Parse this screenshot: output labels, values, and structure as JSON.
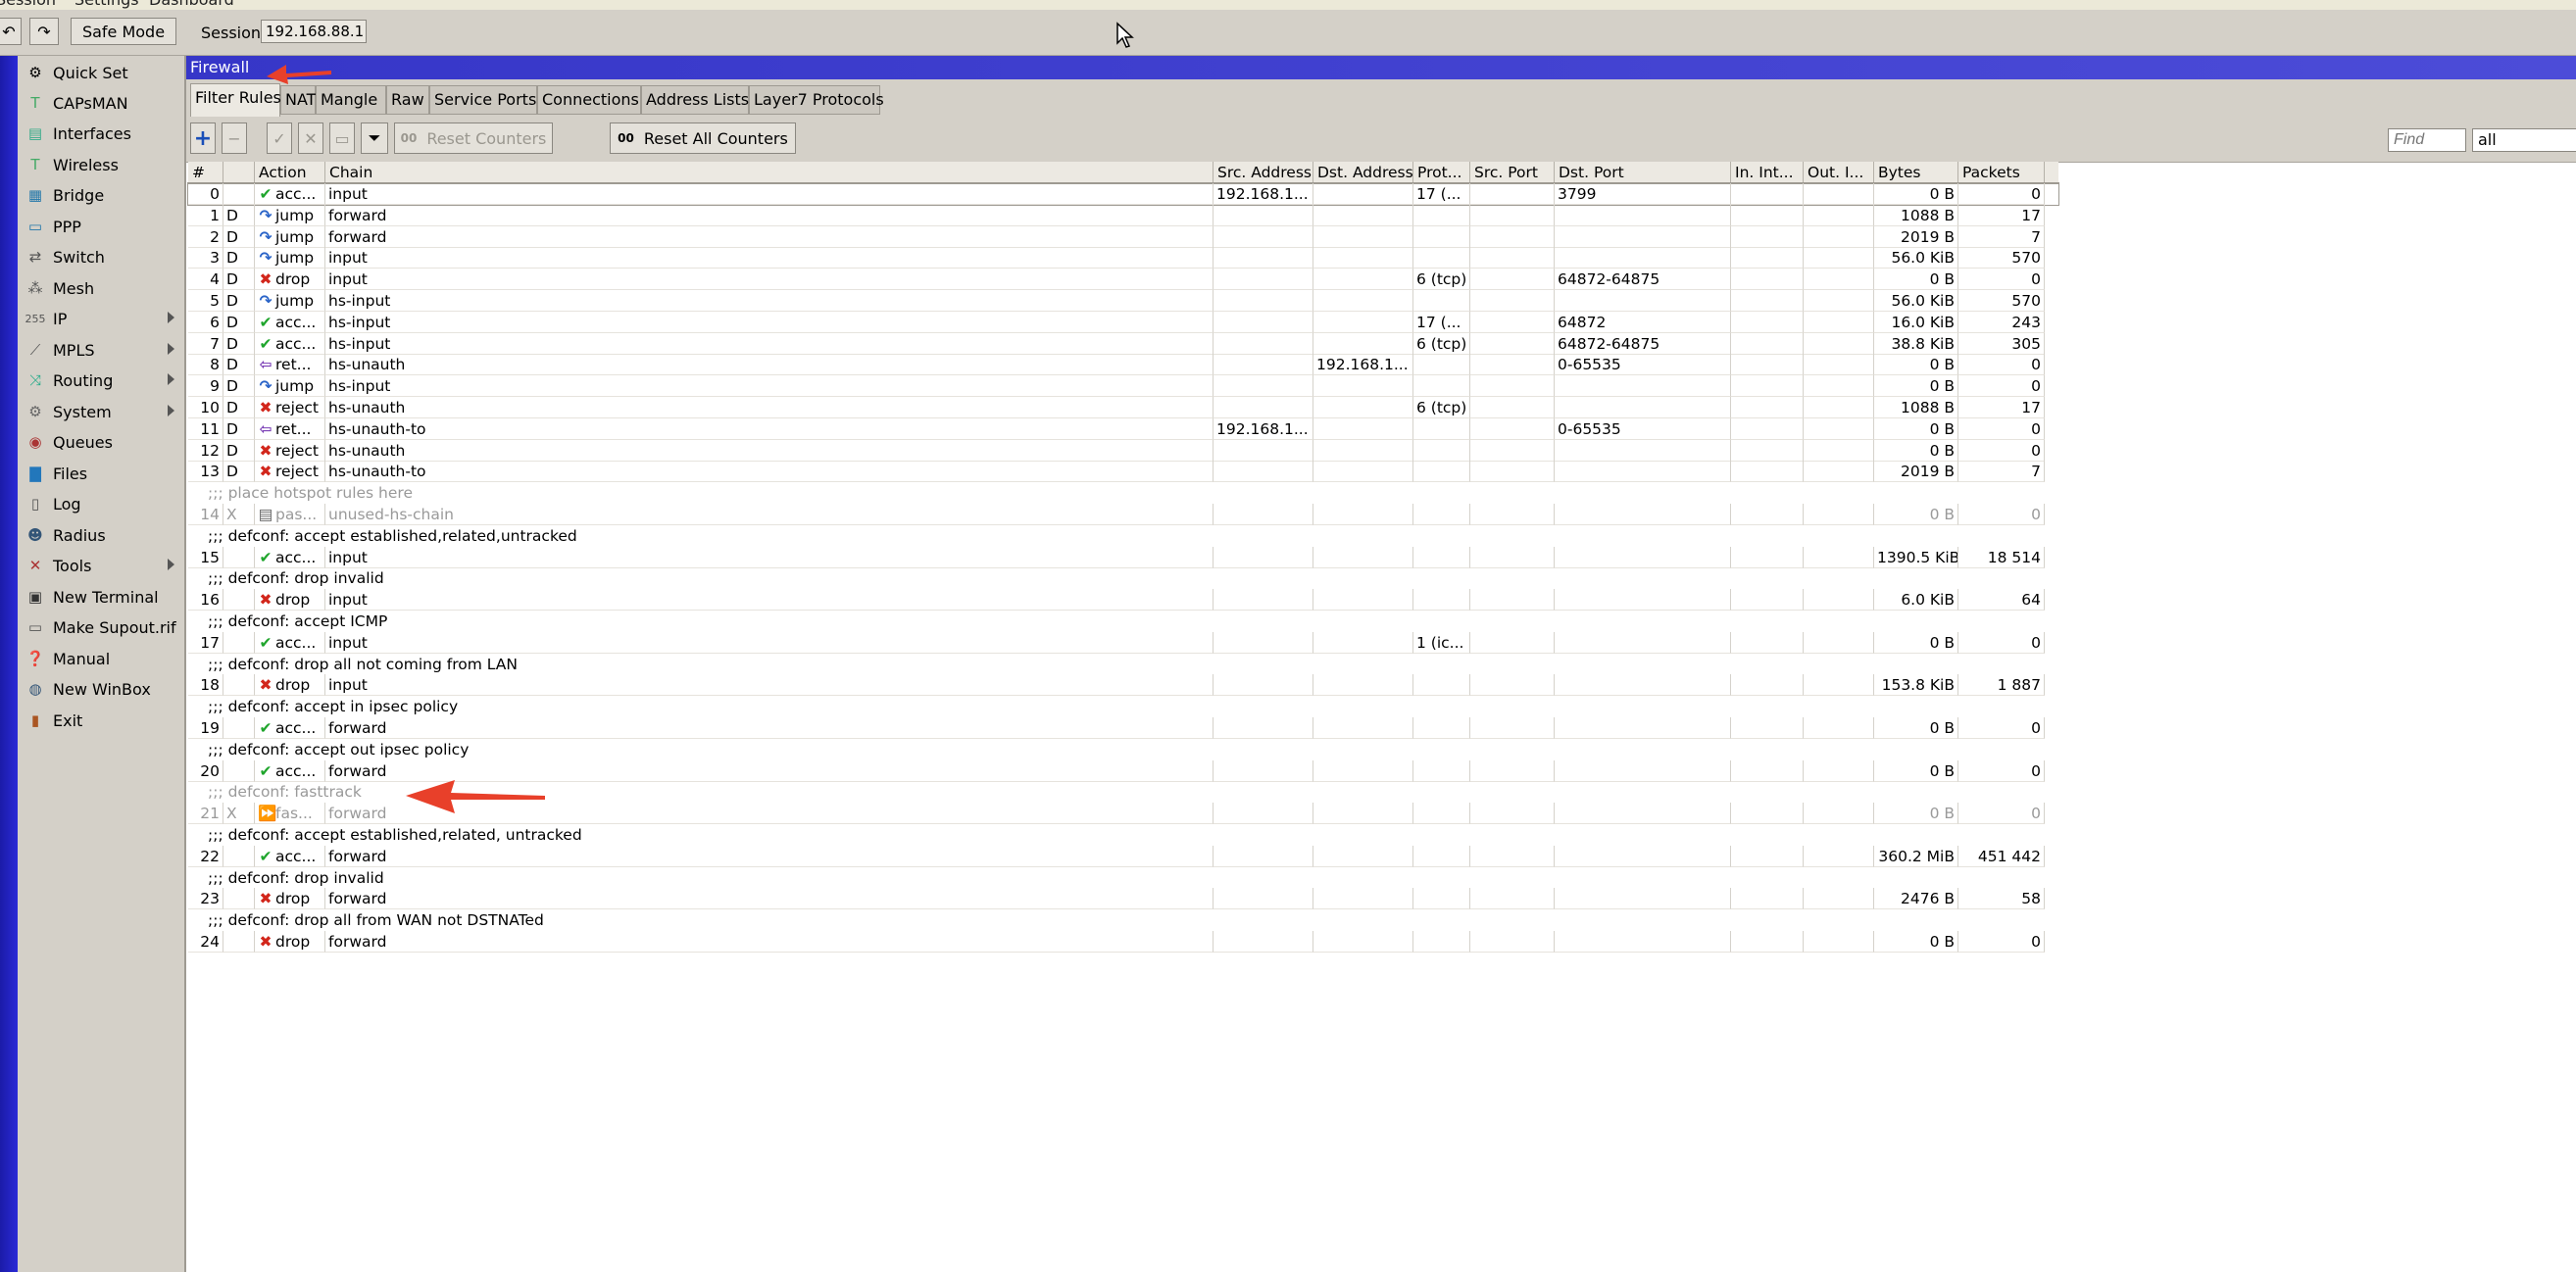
{
  "menu": [
    "Session",
    "Settings",
    "Dashboard"
  ],
  "toolbar": {
    "undo_icon": "undo-icon",
    "redo_icon": "redo-icon",
    "safe_mode_label": "Safe Mode",
    "session_label": "Session:",
    "session_value": "192.168.88.1"
  },
  "sidebar": {
    "items": [
      {
        "label": "Quick Set",
        "icon": "quickset-icon",
        "submenu": false
      },
      {
        "label": "CAPsMAN",
        "icon": "capsman-icon",
        "submenu": false
      },
      {
        "label": "Interfaces",
        "icon": "interfaces-icon",
        "submenu": false
      },
      {
        "label": "Wireless",
        "icon": "wireless-icon",
        "submenu": false
      },
      {
        "label": "Bridge",
        "icon": "bridge-icon",
        "submenu": false
      },
      {
        "label": "PPP",
        "icon": "ppp-icon",
        "submenu": false
      },
      {
        "label": "Switch",
        "icon": "switch-icon",
        "submenu": false
      },
      {
        "label": "Mesh",
        "icon": "mesh-icon",
        "submenu": false
      },
      {
        "label": "IP",
        "icon": "ip-icon",
        "submenu": true
      },
      {
        "label": "MPLS",
        "icon": "mpls-icon",
        "submenu": true
      },
      {
        "label": "Routing",
        "icon": "routing-icon",
        "submenu": true
      },
      {
        "label": "System",
        "icon": "system-icon",
        "submenu": true
      },
      {
        "label": "Queues",
        "icon": "queues-icon",
        "submenu": false
      },
      {
        "label": "Files",
        "icon": "files-icon",
        "submenu": false
      },
      {
        "label": "Log",
        "icon": "log-icon",
        "submenu": false
      },
      {
        "label": "Radius",
        "icon": "radius-icon",
        "submenu": false
      },
      {
        "label": "Tools",
        "icon": "tools-icon",
        "submenu": true
      },
      {
        "label": "New Terminal",
        "icon": "terminal-icon",
        "submenu": false
      },
      {
        "label": "Make Supout.rif",
        "icon": "supout-icon",
        "submenu": false
      },
      {
        "label": "Manual",
        "icon": "manual-icon",
        "submenu": false
      },
      {
        "label": "New WinBox",
        "icon": "winbox-icon",
        "submenu": false
      },
      {
        "label": "Exit",
        "icon": "exit-icon",
        "submenu": false
      }
    ]
  },
  "window": {
    "title": "Firewall",
    "tabs": [
      "Filter Rules",
      "NAT",
      "Mangle",
      "Raw",
      "Service Ports",
      "Connections",
      "Address Lists",
      "Layer7 Protocols"
    ],
    "active_tab": "Filter Rules"
  },
  "subtoolbar": {
    "reset_counters": "Reset Counters",
    "reset_all_counters": "Reset All Counters",
    "counter_icon_text": "00",
    "find_placeholder": "Find",
    "filter_value": "all"
  },
  "table": {
    "columns": [
      "#",
      "",
      "Action",
      "Chain",
      "Src. Address",
      "Dst. Address",
      "Prot...",
      "Src. Port",
      "Dst. Port",
      "In. Int...",
      "Out. I...",
      "Bytes",
      "Packets"
    ],
    "rows": [
      {
        "type": "rule",
        "num": "0",
        "flag": "",
        "action": "acc...",
        "icon": "accept",
        "chain": "input",
        "src": "192.168.1...",
        "dst": "",
        "proto": "17 (...",
        "sport": "",
        "dport": "3799",
        "bytes": "0 B",
        "packets": "0"
      },
      {
        "type": "rule",
        "num": "1",
        "flag": "D",
        "action": "jump",
        "icon": "jump",
        "chain": "forward",
        "src": "",
        "dst": "",
        "proto": "",
        "sport": "",
        "dport": "",
        "bytes": "1088 B",
        "packets": "17"
      },
      {
        "type": "rule",
        "num": "2",
        "flag": "D",
        "action": "jump",
        "icon": "jump",
        "chain": "forward",
        "src": "",
        "dst": "",
        "proto": "",
        "sport": "",
        "dport": "",
        "bytes": "2019 B",
        "packets": "7"
      },
      {
        "type": "rule",
        "num": "3",
        "flag": "D",
        "action": "jump",
        "icon": "jump",
        "chain": "input",
        "src": "",
        "dst": "",
        "proto": "",
        "sport": "",
        "dport": "",
        "bytes": "56.0 KiB",
        "packets": "570"
      },
      {
        "type": "rule",
        "num": "4",
        "flag": "D",
        "action": "drop",
        "icon": "drop",
        "chain": "input",
        "src": "",
        "dst": "",
        "proto": "6 (tcp)",
        "sport": "",
        "dport": "64872-64875",
        "bytes": "0 B",
        "packets": "0"
      },
      {
        "type": "rule",
        "num": "5",
        "flag": "D",
        "action": "jump",
        "icon": "jump",
        "chain": "hs-input",
        "src": "",
        "dst": "",
        "proto": "",
        "sport": "",
        "dport": "",
        "bytes": "56.0 KiB",
        "packets": "570"
      },
      {
        "type": "rule",
        "num": "6",
        "flag": "D",
        "action": "acc...",
        "icon": "accept",
        "chain": "hs-input",
        "src": "",
        "dst": "",
        "proto": "17 (...",
        "sport": "",
        "dport": "64872",
        "bytes": "16.0 KiB",
        "packets": "243"
      },
      {
        "type": "rule",
        "num": "7",
        "flag": "D",
        "action": "acc...",
        "icon": "accept",
        "chain": "hs-input",
        "src": "",
        "dst": "",
        "proto": "6 (tcp)",
        "sport": "",
        "dport": "64872-64875",
        "bytes": "38.8 KiB",
        "packets": "305"
      },
      {
        "type": "rule",
        "num": "8",
        "flag": "D",
        "action": "ret...",
        "icon": "return",
        "chain": "hs-unauth",
        "src": "",
        "dst": "192.168.1...",
        "proto": "",
        "sport": "",
        "dport": "0-65535",
        "bytes": "0 B",
        "packets": "0"
      },
      {
        "type": "rule",
        "num": "9",
        "flag": "D",
        "action": "jump",
        "icon": "jump",
        "chain": "hs-input",
        "src": "",
        "dst": "",
        "proto": "",
        "sport": "",
        "dport": "",
        "bytes": "0 B",
        "packets": "0"
      },
      {
        "type": "rule",
        "num": "10",
        "flag": "D",
        "action": "reject",
        "icon": "drop",
        "chain": "hs-unauth",
        "src": "",
        "dst": "",
        "proto": "6 (tcp)",
        "sport": "",
        "dport": "",
        "bytes": "1088 B",
        "packets": "17"
      },
      {
        "type": "rule",
        "num": "11",
        "flag": "D",
        "action": "ret...",
        "icon": "return",
        "chain": "hs-unauth-to",
        "src": "192.168.1...",
        "dst": "",
        "proto": "",
        "sport": "",
        "dport": "0-65535",
        "bytes": "0 B",
        "packets": "0"
      },
      {
        "type": "rule",
        "num": "12",
        "flag": "D",
        "action": "reject",
        "icon": "drop",
        "chain": "hs-unauth",
        "src": "",
        "dst": "",
        "proto": "",
        "sport": "",
        "dport": "",
        "bytes": "0 B",
        "packets": "0"
      },
      {
        "type": "rule",
        "num": "13",
        "flag": "D",
        "action": "reject",
        "icon": "drop",
        "chain": "hs-unauth-to",
        "src": "",
        "dst": "",
        "proto": "",
        "sport": "",
        "dport": "",
        "bytes": "2019 B",
        "packets": "7"
      },
      {
        "type": "comment",
        "text": ";;; place hotspot rules here",
        "disabled": true
      },
      {
        "type": "rule",
        "num": "14",
        "flag": "X",
        "action": "pas...",
        "icon": "passthrough",
        "chain": "unused-hs-chain",
        "src": "",
        "dst": "",
        "proto": "",
        "sport": "",
        "dport": "",
        "bytes": "0 B",
        "packets": "0",
        "disabled": true
      },
      {
        "type": "comment",
        "text": ";;; defconf: accept established,related,untracked"
      },
      {
        "type": "rule",
        "num": "15",
        "flag": "",
        "action": "acc...",
        "icon": "accept",
        "chain": "input",
        "src": "",
        "dst": "",
        "proto": "",
        "sport": "",
        "dport": "",
        "bytes": "1390.5 KiB",
        "packets": "18 514"
      },
      {
        "type": "comment",
        "text": ";;; defconf: drop invalid"
      },
      {
        "type": "rule",
        "num": "16",
        "flag": "",
        "action": "drop",
        "icon": "drop",
        "chain": "input",
        "src": "",
        "dst": "",
        "proto": "",
        "sport": "",
        "dport": "",
        "bytes": "6.0 KiB",
        "packets": "64"
      },
      {
        "type": "comment",
        "text": ";;; defconf: accept ICMP"
      },
      {
        "type": "rule",
        "num": "17",
        "flag": "",
        "action": "acc...",
        "icon": "accept",
        "chain": "input",
        "src": "",
        "dst": "",
        "proto": "1 (ic...",
        "sport": "",
        "dport": "",
        "bytes": "0 B",
        "packets": "0"
      },
      {
        "type": "comment",
        "text": ";;; defconf: drop all not coming from LAN"
      },
      {
        "type": "rule",
        "num": "18",
        "flag": "",
        "action": "drop",
        "icon": "drop",
        "chain": "input",
        "src": "",
        "dst": "",
        "proto": "",
        "sport": "",
        "dport": "",
        "bytes": "153.8 KiB",
        "packets": "1 887"
      },
      {
        "type": "comment",
        "text": ";;; defconf: accept in ipsec policy"
      },
      {
        "type": "rule",
        "num": "19",
        "flag": "",
        "action": "acc...",
        "icon": "accept",
        "chain": "forward",
        "src": "",
        "dst": "",
        "proto": "",
        "sport": "",
        "dport": "",
        "bytes": "0 B",
        "packets": "0"
      },
      {
        "type": "comment",
        "text": ";;; defconf: accept out ipsec policy"
      },
      {
        "type": "rule",
        "num": "20",
        "flag": "",
        "action": "acc...",
        "icon": "accept",
        "chain": "forward",
        "src": "",
        "dst": "",
        "proto": "",
        "sport": "",
        "dport": "",
        "bytes": "0 B",
        "packets": "0"
      },
      {
        "type": "comment",
        "text": ";;; defconf: fasttrack",
        "disabled": true
      },
      {
        "type": "rule",
        "num": "21",
        "flag": "X",
        "action": "fas...",
        "icon": "fasttrack",
        "chain": "forward",
        "src": "",
        "dst": "",
        "proto": "",
        "sport": "",
        "dport": "",
        "bytes": "0 B",
        "packets": "0",
        "disabled": true
      },
      {
        "type": "comment",
        "text": ";;; defconf: accept established,related, untracked"
      },
      {
        "type": "rule",
        "num": "22",
        "flag": "",
        "action": "acc...",
        "icon": "accept",
        "chain": "forward",
        "src": "",
        "dst": "",
        "proto": "",
        "sport": "",
        "dport": "",
        "bytes": "360.2 MiB",
        "packets": "451 442"
      },
      {
        "type": "comment",
        "text": ";;; defconf: drop invalid"
      },
      {
        "type": "rule",
        "num": "23",
        "flag": "",
        "action": "drop",
        "icon": "drop",
        "chain": "forward",
        "src": "",
        "dst": "",
        "proto": "",
        "sport": "",
        "dport": "",
        "bytes": "2476 B",
        "packets": "58"
      },
      {
        "type": "comment",
        "text": ";;; defconf:  drop all from WAN not DSTNATed"
      },
      {
        "type": "rule",
        "num": "24",
        "flag": "",
        "action": "drop",
        "icon": "drop",
        "chain": "forward",
        "src": "",
        "dst": "",
        "proto": "",
        "sport": "",
        "dport": "",
        "bytes": "0 B",
        "packets": "0"
      }
    ]
  },
  "colors": {
    "title_bar": "#3c3ccc",
    "left_strip": "#2020b8",
    "accept": "#1fa52c",
    "drop": "#d2261b",
    "annotation_arrow": "#e8402a"
  }
}
